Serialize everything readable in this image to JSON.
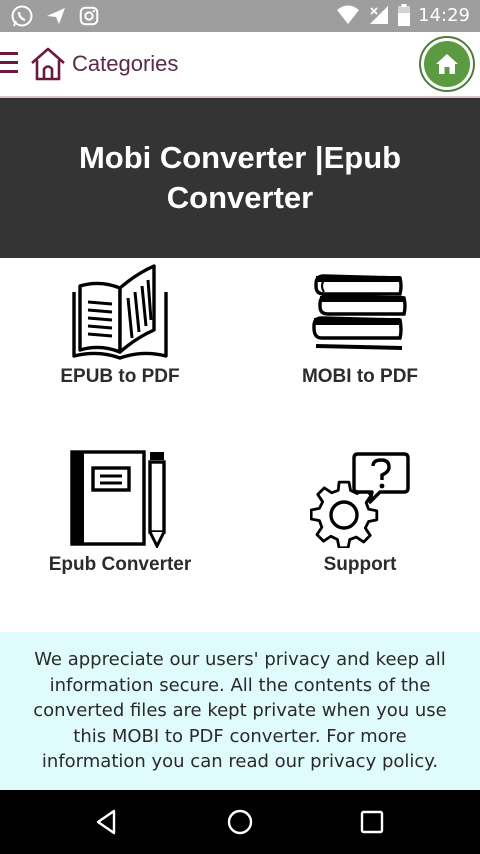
{
  "status_bar": {
    "time": "14:29",
    "left_icons": [
      "whatsapp-icon",
      "send-icon",
      "instagram-icon"
    ],
    "right_icons": [
      "wifi-icon",
      "signal-icon",
      "battery-icon"
    ]
  },
  "app_bar": {
    "categories_label": "Categories",
    "accent_color": "#6b1a3e",
    "home_color": "#5b9a40"
  },
  "hero": {
    "title": "Mobi Converter |Epub Converter",
    "background": "#343434"
  },
  "tiles": [
    {
      "label": "EPUB to PDF",
      "icon": "open-book-icon"
    },
    {
      "label": "MOBI to PDF",
      "icon": "book-stack-icon"
    },
    {
      "label": "Epub Converter",
      "icon": "notebook-pencil-icon"
    },
    {
      "label": "Support",
      "icon": "gear-question-icon"
    }
  ],
  "privacy": {
    "text": "We appreciate our users' privacy and keep all information secure. All the contents of the converted files are kept private when you use this MOBI to PDF converter. For more information you can read our privacy policy.",
    "background": "#e0fbfb"
  },
  "nav_bar": {
    "buttons": [
      "back-icon",
      "home-circle-icon",
      "recents-icon"
    ]
  }
}
